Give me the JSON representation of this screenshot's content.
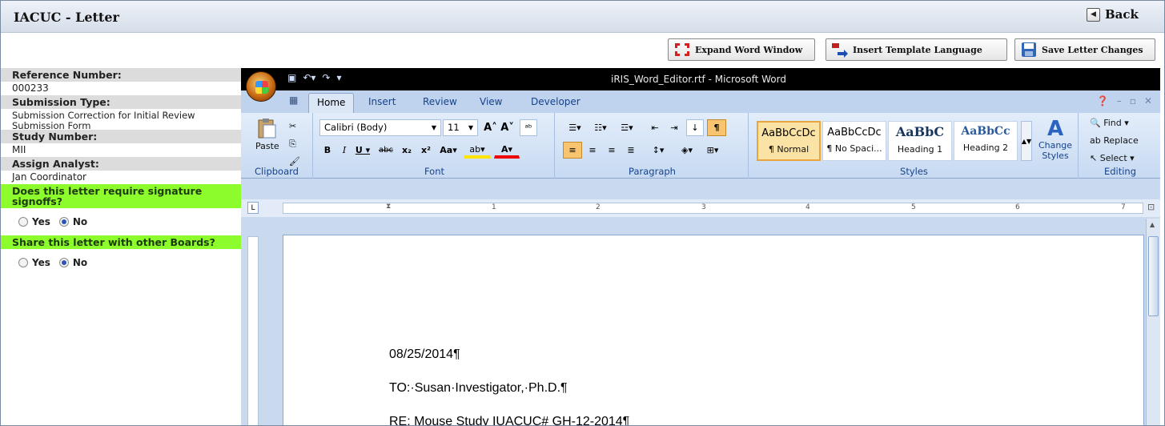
{
  "header": {
    "title": "IACUC - Letter",
    "back_label": "Back"
  },
  "toolbar": {
    "expand_label": "Expand Word Window",
    "insert_label": "Insert Template Language",
    "save_label": "Save Letter Changes"
  },
  "left": {
    "reference_label": "Reference Number:",
    "reference_value": "000233",
    "submission_type_label": "Submission Type:",
    "submission_type_value": "Submission Correction for Initial Review Submission Form",
    "study_label": "Study Number:",
    "study_value": "MII",
    "analyst_label": "Assign Analyst:",
    "analyst_value": "Jan Coordinator",
    "signature_question": "Does this letter require signature signoffs?",
    "signature_selected": "No",
    "share_question": "Share this letter with other Boards?",
    "share_selected": "No",
    "yes_label": "Yes",
    "no_label": "No"
  },
  "word": {
    "window_title": "iRIS_Word_Editor.rtf - Microsoft Word",
    "tabs": [
      "Home",
      "Insert",
      "Review",
      "View",
      "Developer"
    ],
    "active_tab": "Home",
    "font_name": "Calibri (Body)",
    "font_size": "11",
    "paste_label": "Paste",
    "groups": {
      "clipboard": "Clipboard",
      "font": "Font",
      "paragraph": "Paragraph",
      "styles": "Styles",
      "editing": "Editing"
    },
    "styles": [
      {
        "preview": "AaBbCcDc",
        "name": "¶ Normal"
      },
      {
        "preview": "AaBbCcDc",
        "name": "¶ No Spaci..."
      },
      {
        "preview": "AaBbC",
        "name": "Heading 1"
      },
      {
        "preview": "AaBbCc",
        "name": "Heading 2"
      }
    ],
    "change_styles": "Change Styles",
    "editing": {
      "find": "Find",
      "replace": "Replace",
      "select": "Select"
    },
    "document_lines": [
      "08/25/2014¶",
      "TO:·Susan·Investigator,·Ph.D.¶",
      "RE: Mouse Study IUACUC# GH-12-2014¶"
    ]
  }
}
